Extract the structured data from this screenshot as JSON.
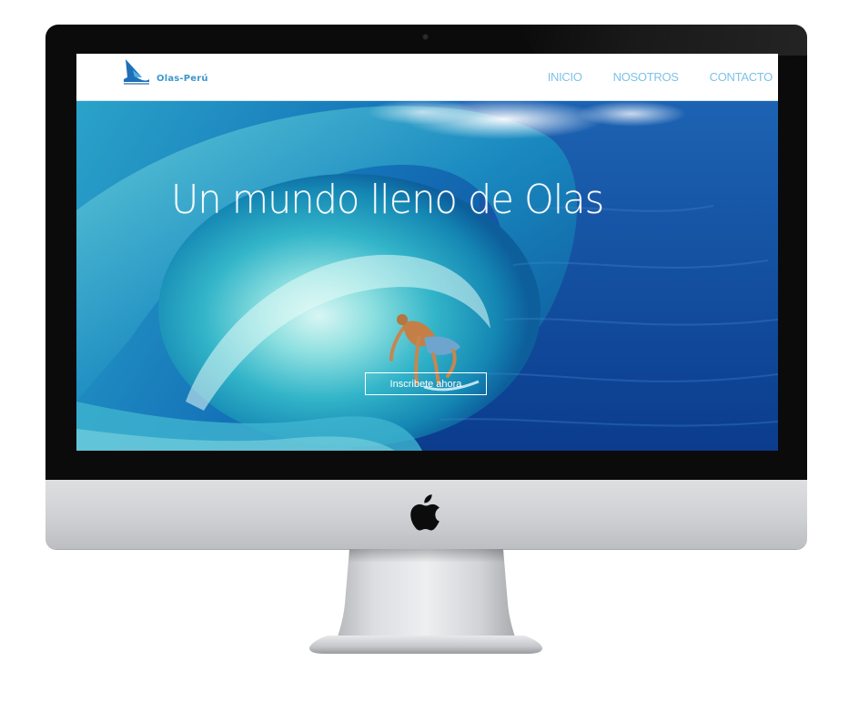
{
  "brand": {
    "name": "Olas-Perú",
    "logo_icon": "shark-fin-logo-icon",
    "accent": "#3c98cc"
  },
  "nav": {
    "items": [
      {
        "label": "INICIO"
      },
      {
        "label": "NOSOTROS"
      },
      {
        "label": "CONTACTO"
      }
    ],
    "color": "#7ec2e6"
  },
  "hero": {
    "title": "Un mundo lleno de Olas",
    "cta_label": "Inscribete ahora",
    "image": "surfer-in-wave-image"
  },
  "device": {
    "type": "iMac",
    "logo_icon": "apple-logo-icon"
  }
}
